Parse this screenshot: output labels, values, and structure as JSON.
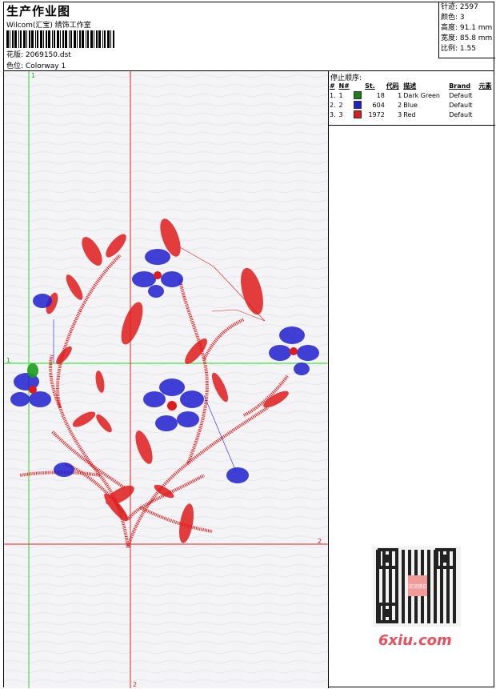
{
  "header": {
    "title": "生产作业图",
    "subtitle": "Wilcom(汇宝) 绣饰工作室",
    "design_label": "花版:",
    "design_value": "2069150.dst",
    "colorway_label": "色位:",
    "colorway_value": "Colorway 1"
  },
  "stats": {
    "stitches": "针迹: 2597",
    "colors": "颜色: 3",
    "height": "高度: 91.1 mm",
    "width": "宽度: 85.8 mm",
    "scale": "比例: 1.55"
  },
  "stop_sequence": {
    "heading": "停止顺序:",
    "columns": [
      "#",
      "N#",
      "St.",
      "代码",
      "描述",
      "Brand",
      "元素"
    ],
    "rows": [
      {
        "idx": "1.",
        "n": "1",
        "color": "#1a7f1a",
        "st": "18",
        "code": "1",
        "desc": "Dark Green",
        "brand": "Default"
      },
      {
        "idx": "2.",
        "n": "2",
        "color": "#1f1fd0",
        "st": "604",
        "code": "2",
        "desc": "Blue",
        "brand": "Default"
      },
      {
        "idx": "3.",
        "n": "3",
        "color": "#e01a1a",
        "st": "1972",
        "code": "3",
        "desc": "Red",
        "brand": "Default"
      }
    ]
  },
  "guides": {
    "green_v": "1",
    "green_h": "1",
    "red_v": "2",
    "red_h": "2"
  },
  "colors": {
    "thread_red": "#e01a1a",
    "thread_blue": "#1f1fd0",
    "thread_green": "#1a7f1a",
    "guide_green": "#22dd22",
    "guide_red": "#e02020"
  },
  "watermark": "6xiu.com",
  "qr_text": "汉汉锈仿"
}
